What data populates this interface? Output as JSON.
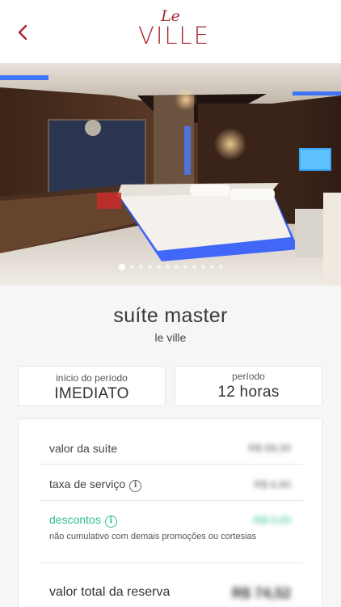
{
  "header": {
    "back_icon": "chevron-left-icon",
    "logo_top": "Le",
    "logo_main": "VILLE",
    "brand_color": "#a7262c"
  },
  "gallery": {
    "image_subject": "hotel-suite-photo",
    "slide_count": 12,
    "active_slide": 1
  },
  "suite": {
    "name": "suíte master",
    "hotel": "le ville"
  },
  "period": {
    "start_label": "início do período",
    "start_value": "IMEDIATO",
    "duration_label": "período",
    "duration_value": "12 horas"
  },
  "pricing": {
    "suite_label": "valor da suíte",
    "suite_value": "R$ 68,00",
    "service_label": "taxa de serviço",
    "service_value": "R$ 6,80",
    "discount_label": "descontos",
    "discount_value": "-R$ 0,00",
    "discount_note": "não cumulativo com demais promoções ou cortesias",
    "total_label": "valor total da reserva",
    "total_value": "R$ 74,52",
    "discount_color": "#2fbf8f"
  }
}
